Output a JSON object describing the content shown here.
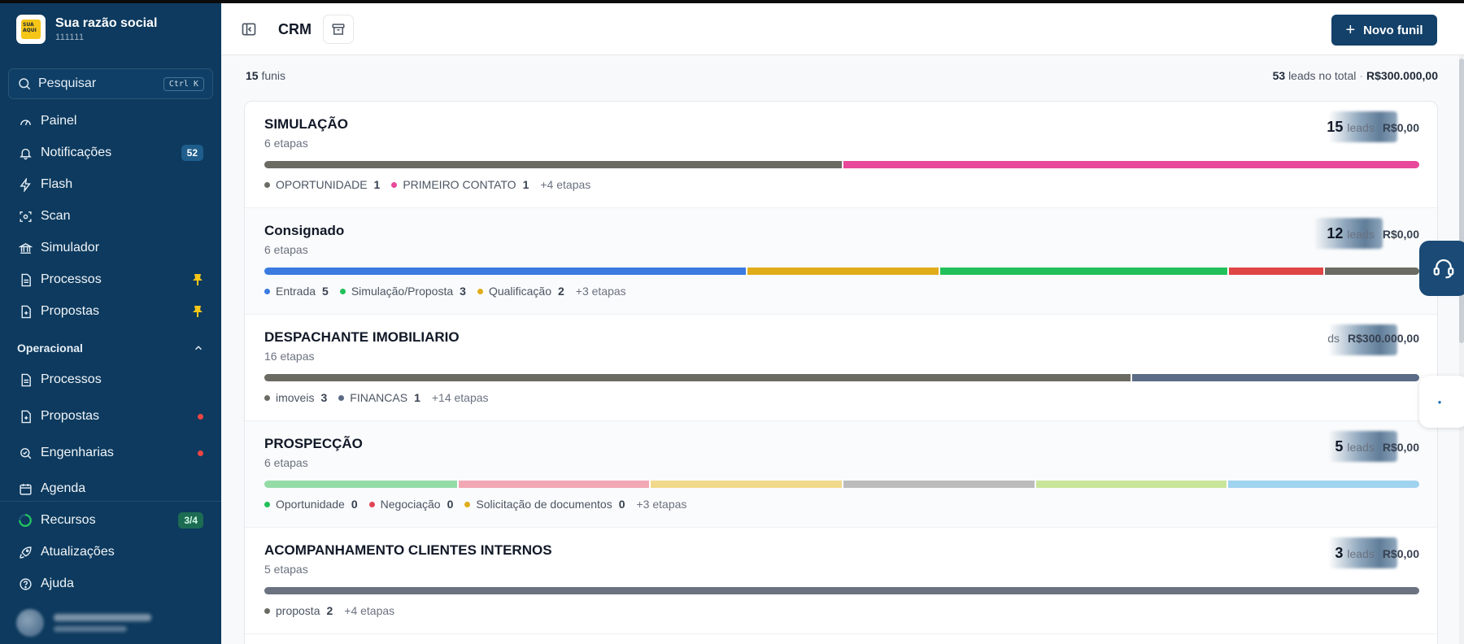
{
  "brand": {
    "name": "Sua razão social",
    "id": "111111",
    "logo_text": "SUA AQUI"
  },
  "search": {
    "label": "Pesquisar",
    "shortcut": "Ctrl K"
  },
  "sidebar": {
    "items": [
      {
        "label": "Painel",
        "icon": "gauge-icon"
      },
      {
        "label": "Notificações",
        "icon": "bell-icon",
        "badge": "52"
      },
      {
        "label": "Flash",
        "icon": "bolt-icon"
      },
      {
        "label": "Scan",
        "icon": "scan-icon"
      },
      {
        "label": "Simulador",
        "icon": "bank-icon"
      },
      {
        "label": "Processos",
        "icon": "document-icon",
        "pinned": true
      },
      {
        "label": "Propostas",
        "icon": "file-plus-icon",
        "pinned": true
      }
    ],
    "section": {
      "label": "Operacional"
    },
    "section_items": [
      {
        "label": "Processos",
        "icon": "document-icon"
      },
      {
        "label": "Propostas",
        "icon": "file-plus-icon",
        "alert": true
      },
      {
        "label": "Engenharias",
        "icon": "search-check-icon",
        "alert": true
      },
      {
        "label": "Agenda",
        "icon": "calendar-icon"
      }
    ],
    "footer": [
      {
        "label": "Recursos",
        "icon": "progress-ring-icon",
        "badge": "3/4"
      },
      {
        "label": "Atualizações",
        "icon": "rocket-icon"
      },
      {
        "label": "Ajuda",
        "icon": "help-circle-icon"
      }
    ]
  },
  "header": {
    "title": "CRM",
    "new_button": "Novo funil"
  },
  "summary": {
    "funnels_count": "15",
    "funnels_label": "funis",
    "leads_count": "53",
    "leads_label": "leads no total",
    "total_value": "R$300.000,00"
  },
  "funnels": [
    {
      "title": "SIMULAÇÃO",
      "stages": "6 etapas",
      "leads": "15",
      "leads_label": "leads",
      "value": "R$0,00",
      "segments": [
        {
          "color": "#6b6b63",
          "share": 0.5
        },
        {
          "color": "#e7489a",
          "share": 0.5
        }
      ],
      "legend": [
        {
          "label": "OPORTUNIDADE",
          "count": "1",
          "color": "#6b6b63"
        },
        {
          "label": "PRIMEIRO CONTATO",
          "count": "1",
          "color": "#e7489a"
        }
      ],
      "more": "+4 etapas"
    },
    {
      "title": "Consignado",
      "stages": "6 etapas",
      "leads": "12",
      "leads_label": "leads",
      "value": "R$0,00",
      "segments": [
        {
          "color": "#3b7be0",
          "share": 0.417
        },
        {
          "color": "#e0ac1a",
          "share": 0.167
        },
        {
          "color": "#22c05a",
          "share": 0.25
        },
        {
          "color": "#e04545",
          "share": 0.083
        },
        {
          "color": "#6b6b63",
          "share": 0.083
        }
      ],
      "legend": [
        {
          "label": "Entrada",
          "count": "5",
          "color": "#3b7be0"
        },
        {
          "label": "Simulação/Proposta",
          "count": "3",
          "color": "#22c05a"
        },
        {
          "label": "Qualificação",
          "count": "2",
          "color": "#e0ac1a"
        }
      ],
      "more": "+3 etapas"
    },
    {
      "title": "DESPACHANTE IMOBILIARIO",
      "stages": "16 etapas",
      "leads": "",
      "leads_label": "ds",
      "value": "R$300.000,00",
      "segments": [
        {
          "color": "#6b6b63",
          "share": 0.75
        },
        {
          "color": "#5b6b86",
          "share": 0.25
        }
      ],
      "legend": [
        {
          "label": "imoveis",
          "count": "3",
          "color": "#6b6b63"
        },
        {
          "label": "FINANCAS",
          "count": "1",
          "color": "#5b6b86"
        }
      ],
      "more": "+14 etapas"
    },
    {
      "title": "PROSPECÇÃO",
      "stages": "6 etapas",
      "leads": "5",
      "leads_label": "leads",
      "value": "R$0,00",
      "segments": [
        {
          "color": "#94dba6",
          "share": 0.1667
        },
        {
          "color": "#f2a7b4",
          "share": 0.1667
        },
        {
          "color": "#f0d98a",
          "share": 0.1667
        },
        {
          "color": "#bcbcbc",
          "share": 0.1667
        },
        {
          "color": "#c8e59a",
          "share": 0.1666
        },
        {
          "color": "#9fd3ef",
          "share": 0.1666
        }
      ],
      "legend": [
        {
          "label": "Oportunidade",
          "count": "0",
          "color": "#22c05a"
        },
        {
          "label": "Negociação",
          "count": "0",
          "color": "#e04558"
        },
        {
          "label": "Solicitação de documentos",
          "count": "0",
          "color": "#e0ac1a"
        }
      ],
      "more": "+3 etapas"
    },
    {
      "title": "ACOMPANHAMENTO CLIENTES INTERNOS",
      "stages": "5 etapas",
      "leads": "3",
      "leads_label": "leads",
      "value": "R$0,00",
      "segments": [
        {
          "color": "#6b7280",
          "share": 1
        }
      ],
      "legend": [
        {
          "label": "proposta",
          "count": "2",
          "color": "#6b6b63"
        }
      ],
      "more": "+4 etapas"
    }
  ]
}
